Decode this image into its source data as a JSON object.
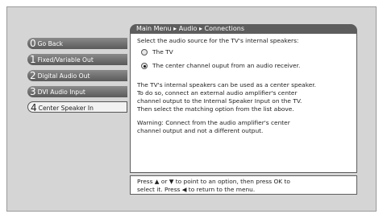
{
  "breadcrumb": "Main Menu ▸ Audio ▸ Connections",
  "menu": [
    {
      "num": "0",
      "label": "Go Back"
    },
    {
      "num": "1",
      "label": "Fixed/Variable Out"
    },
    {
      "num": "2",
      "label": "Digital Audio Out"
    },
    {
      "num": "3",
      "label": "DVI Audio Input"
    },
    {
      "num": "4",
      "label": "Center Speaker In"
    }
  ],
  "content": {
    "prompt": "Select the audio source for the TV's internal speakers:",
    "options": [
      {
        "label": "The TV",
        "selected": false
      },
      {
        "label": "The center channel ouput from an audio receiver.",
        "selected": true
      }
    ],
    "para1": "The TV's internal speakers can be used as a center speaker.\nTo do so, connect an external audio amplifier's center\nchannel output to the Internal Speaker Input on the TV.\nThen select the matching option from the list above.",
    "para2": "Warning: Connect from the audio amplifier's center\nchannel output and not a different output."
  },
  "hint": "Press ▲ or ▼ to point to an option, then press OK to\nselect it. Press ◀ to return to the menu."
}
